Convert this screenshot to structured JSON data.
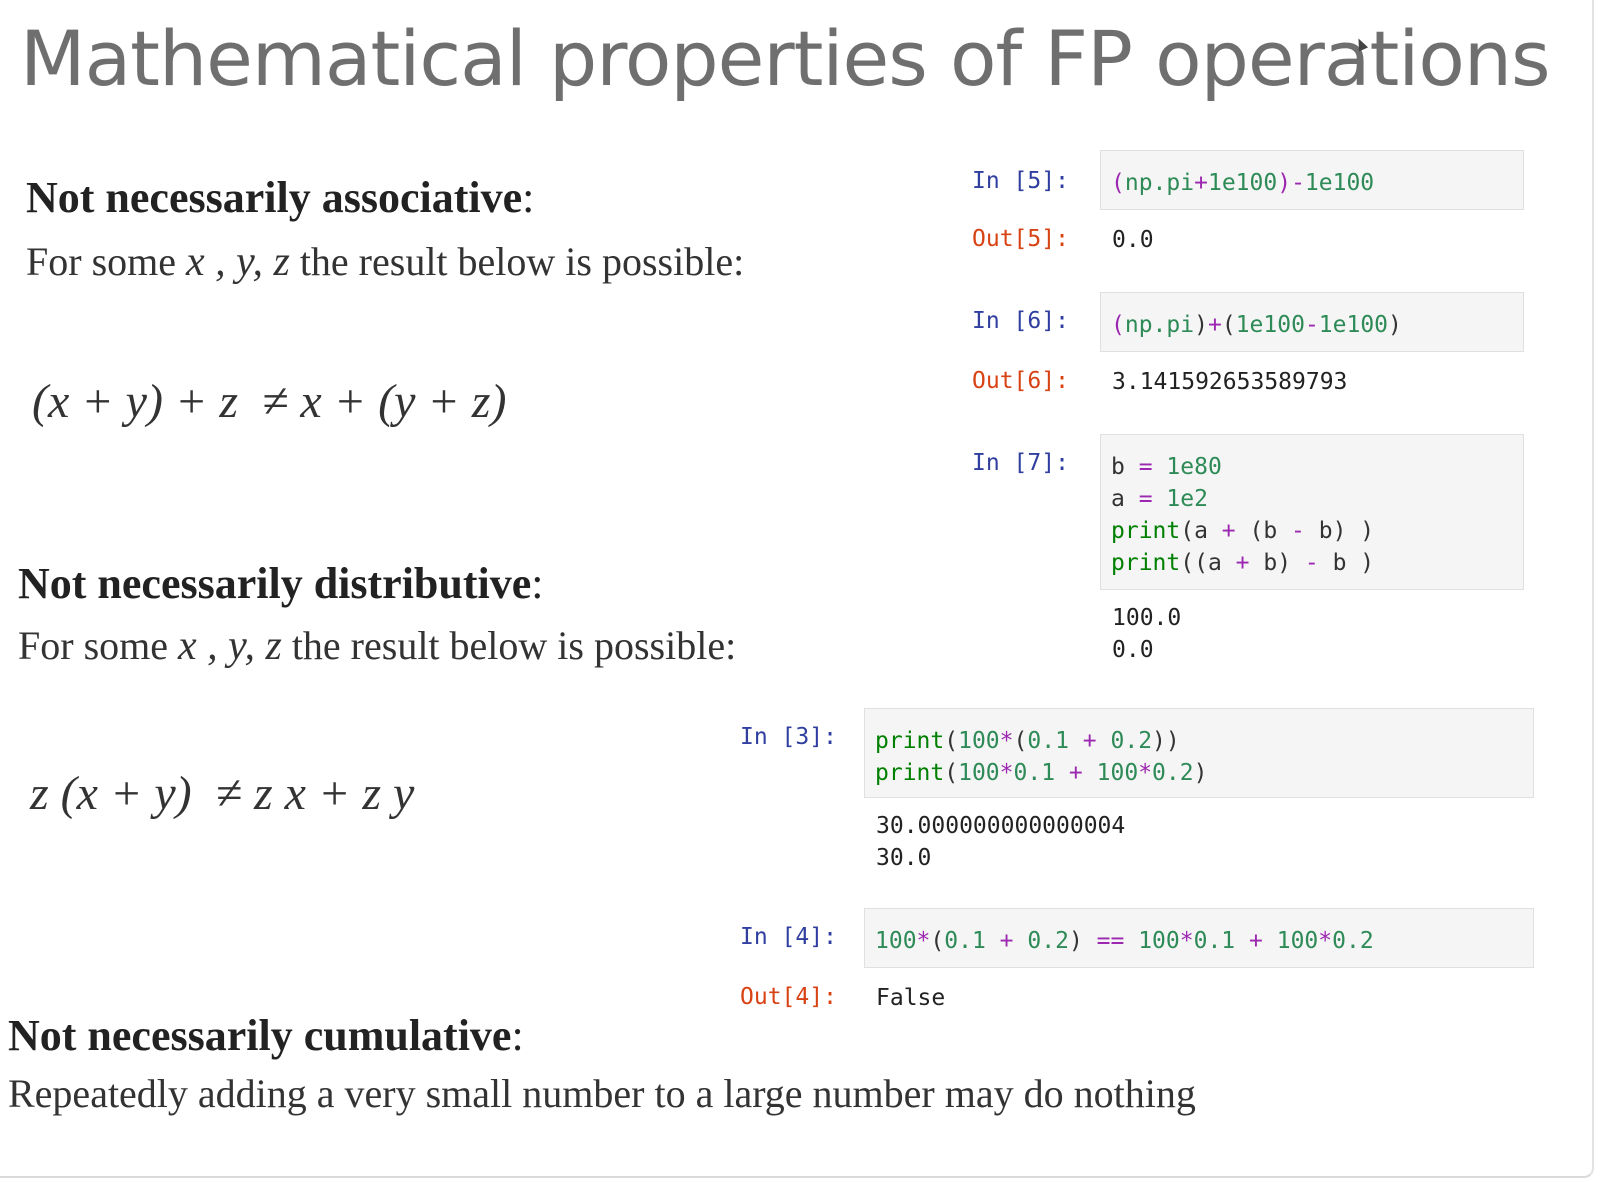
{
  "slide": {
    "title": "Mathematical properties of FP operations",
    "sections": [
      {
        "heading": "Not necessarily associative",
        "line_prefix": "For some",
        "vars": "x , y, z",
        "line_suffix": "the result below is possible:",
        "formula": "(x + y) + z  ≠ x + (y + z)"
      },
      {
        "heading": "Not necessarily distributive",
        "line_prefix": "For some",
        "vars": "x , y, z",
        "line_suffix": "the result below is possible:",
        "formula": "z (x + y)  ≠ z x + z y"
      },
      {
        "heading": "Not necessarily cumulative",
        "line": "Repeatedly adding a very small number to a large number may do nothing"
      }
    ],
    "colon": ":"
  },
  "notebook": {
    "cells": [
      {
        "in_label": "In [5]:",
        "code": [
          "(np.pi+1e100)-1e100"
        ],
        "out_label": "Out[5]:",
        "output": [
          "0.0"
        ]
      },
      {
        "in_label": "In [6]:",
        "code": [
          "(np.pi)+(1e100-1e100)"
        ],
        "out_label": "Out[6]:",
        "output": [
          "3.141592653589793"
        ]
      },
      {
        "in_label": "In [7]:",
        "code": [
          "b = 1e80",
          "a = 1e2",
          "print(a + (b - b) )",
          "print((a + b) - b )"
        ],
        "out_label": "",
        "output": [
          "100.0",
          "0.0"
        ]
      },
      {
        "in_label": "In [3]:",
        "code": [
          "print(100*(0.1 + 0.2))",
          "print(100*0.1 + 100*0.2)"
        ],
        "out_label": "",
        "output": [
          "30.000000000000004",
          "30.0"
        ]
      },
      {
        "in_label": "In [4]:",
        "code": [
          "100*(0.1 + 0.2) == 100*0.1 + 100*0.2"
        ],
        "out_label": "Out[4]:",
        "output": [
          "False"
        ]
      }
    ]
  },
  "colors": {
    "title": "#6f6f6f",
    "in_prompt": "#303f9f",
    "out_prompt": "#d84315",
    "cell_bg": "#f5f5f5",
    "keyword": "#008000",
    "operator": "#9c27b0",
    "number": "#2e8b57"
  },
  "icons": {
    "cursor": "mouse-pointer-icon"
  }
}
